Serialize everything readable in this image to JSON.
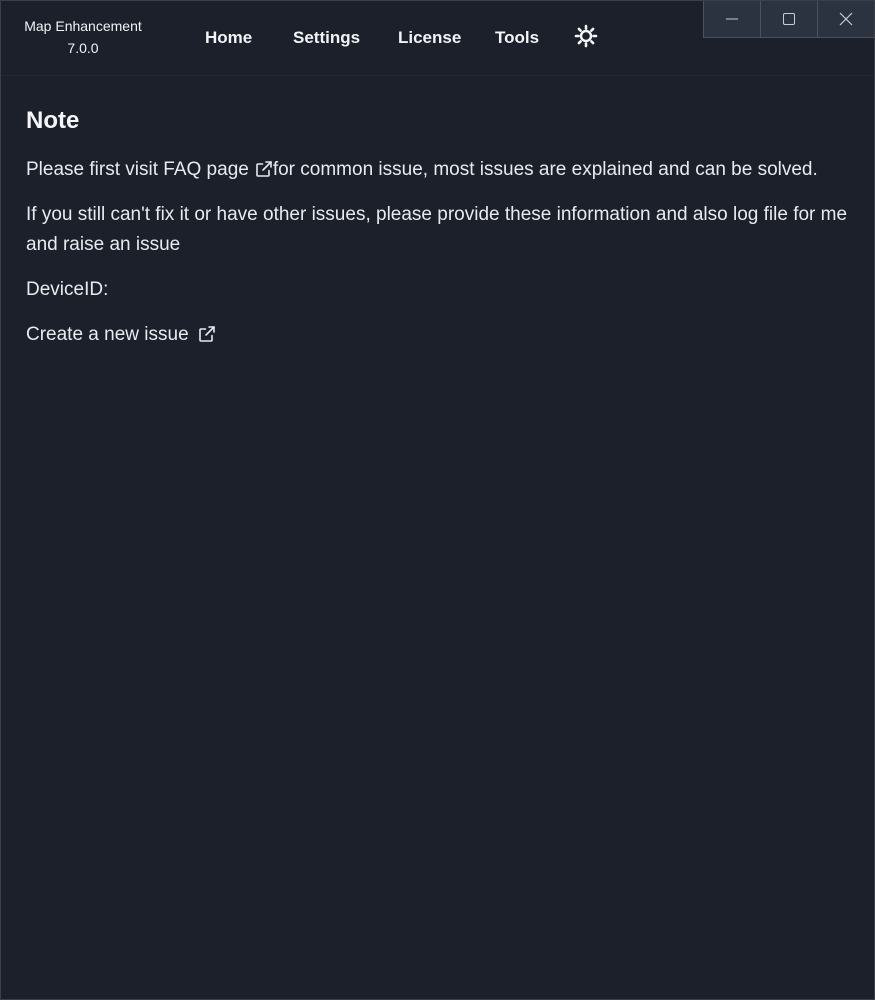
{
  "app": {
    "name": "Map Enhancement",
    "version": "7.0.0"
  },
  "nav": {
    "home": "Home",
    "settings": "Settings",
    "license": "License",
    "tools": "Tools",
    "theme_icon": "sun-icon"
  },
  "window_controls": {
    "minimize_icon": "minimize-icon",
    "maximize_icon": "maximize-icon",
    "close_icon": "close-icon"
  },
  "page": {
    "title": "Note",
    "faq_prefix": "Please first visit ",
    "faq_link": "FAQ page",
    "faq_suffix": "for common issue, most issues are explained and can be solved.",
    "info_text": "If you still can't fix it or have other issues, please provide these information and also log file for me and raise an issue",
    "device_id_label": "DeviceID:",
    "device_id_value": "",
    "new_issue_link": "Create a new issue"
  },
  "colors": {
    "background": "#1b202b",
    "text": "#e8eaee",
    "window_controls_bg": "#2b3340"
  }
}
